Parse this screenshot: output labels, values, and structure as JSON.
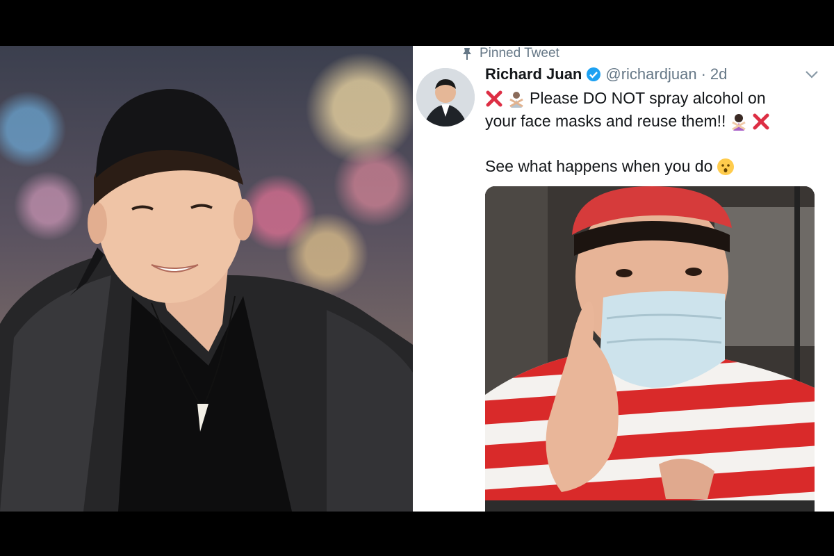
{
  "tweet": {
    "pinned_label": "Pinned Tweet",
    "name": "Richard Juan",
    "handle": "@richardjuan",
    "separator": "·",
    "time": "2d",
    "text_line1": "Please DO NOT spray alcohol on",
    "text_line2": "your face masks and reuse them!!",
    "text_line3": "See what happens when you do"
  },
  "colors": {
    "background": "#000000",
    "tweet_bg": "#ffffff",
    "text": "#14171a",
    "secondary_text": "#657786",
    "verified": "#1da1f2",
    "cross": "#dd2e44"
  },
  "icons": [
    "pin-icon",
    "verified-icon",
    "chevron-down-icon",
    "cross-mark-icon",
    "person-gesturing-no-icon",
    "woman-gesturing-no-icon",
    "hushed-face-icon"
  ]
}
